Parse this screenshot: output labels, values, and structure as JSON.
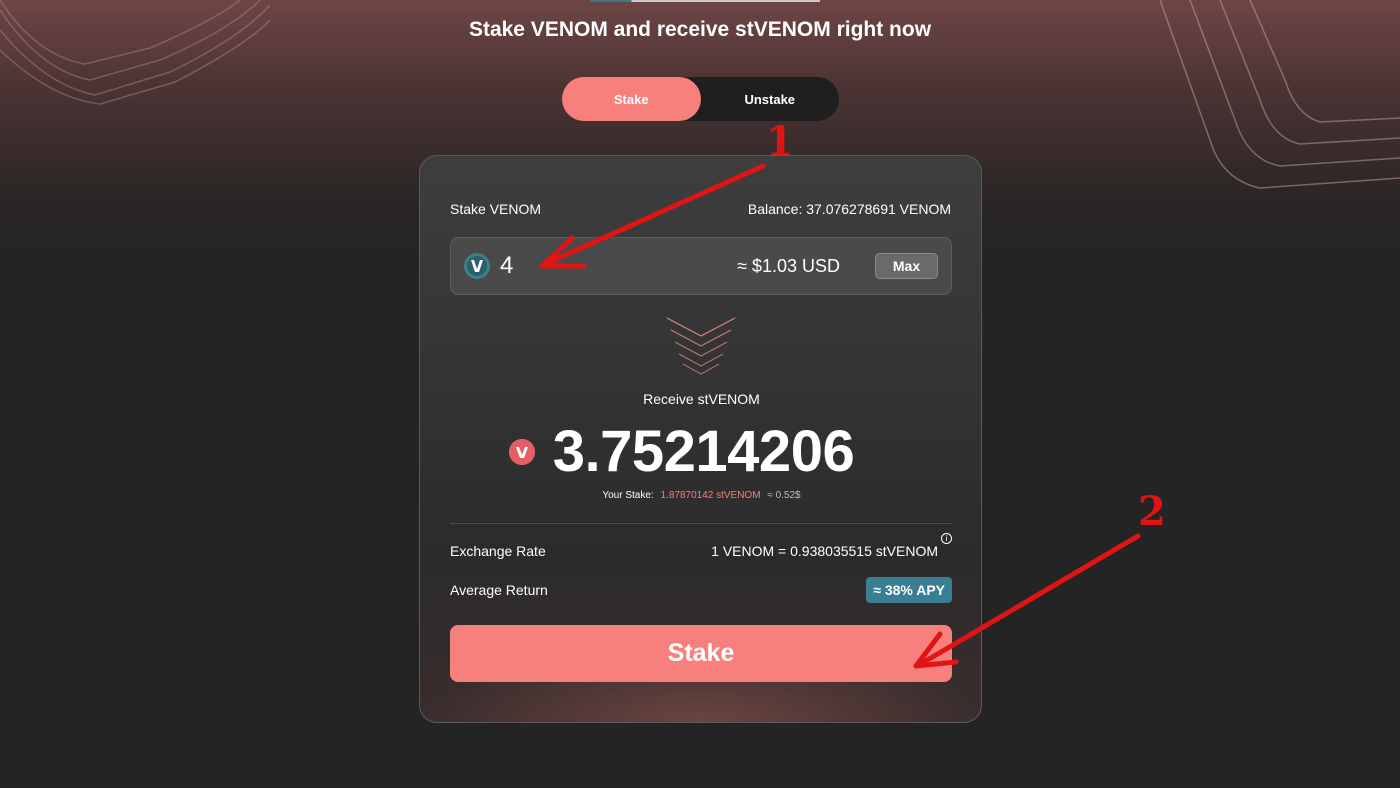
{
  "page": {
    "headline": "Stake VENOM and receive stVENOM right now"
  },
  "tabs": [
    {
      "label": "Stake",
      "active": true
    },
    {
      "label": "Unstake",
      "active": false
    }
  ],
  "stake_form": {
    "label": "Stake VENOM",
    "balance": "Balance: 37.076278691 VENOM",
    "amount_value": "4",
    "token_icon": "venom-token-icon",
    "usd_estimate": "≈ $1.03 USD",
    "max_label": "Max"
  },
  "receive": {
    "label": "Receive stVENOM",
    "token_icon": "stvenom-token-icon",
    "amount": "3.75214206",
    "your_stake_label": "Your Stake:",
    "your_stake_value": "1.87870142 stVENOM",
    "your_stake_usd": "≈ 0.52$"
  },
  "details": {
    "exchange_rate_label": "Exchange Rate",
    "exchange_rate_value": "1 VENOM = 0.938035515 stVENOM",
    "average_return_label": "Average Return",
    "average_return_value": "≈ 38% APY"
  },
  "actions": {
    "stake_button": "Stake"
  },
  "annotations": {
    "marker_1": "1",
    "marker_2": "2"
  },
  "colors": {
    "accent": "#f77f7c",
    "badge": "#3a7e93",
    "background": "#242424",
    "annotation": "#e01414"
  }
}
